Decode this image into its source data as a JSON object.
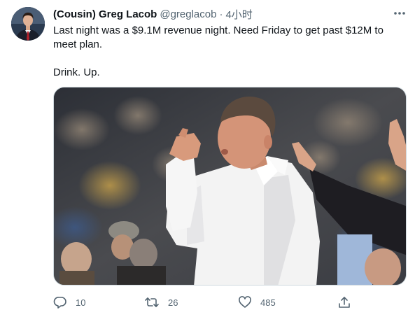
{
  "tweet": {
    "display_name": "(Cousin) Greg Lacob",
    "handle": "@greglacob",
    "separator": "·",
    "time": "4小时",
    "text_line1": "Last night was a $9.1M revenue night. Need Friday to get past $12M to meet plan.",
    "text_line2": "Drink. Up.",
    "more_icon": "more-horizontal-icon"
  },
  "actions": {
    "reply_count": "10",
    "retweet_count": "26",
    "like_count": "485"
  },
  "colors": {
    "text": "#0f1419",
    "secondary": "#536471",
    "border": "#cfd9de"
  }
}
